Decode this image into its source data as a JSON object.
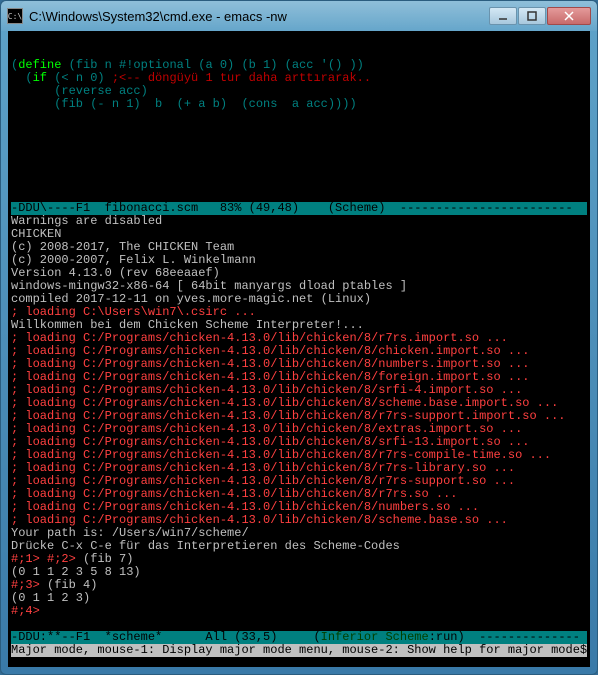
{
  "window": {
    "title": "C:\\Windows\\System32\\cmd.exe - emacs  -nw"
  },
  "code": {
    "l1a": "(",
    "l1b": "define",
    "l1c": " (fib n #!optional (a 0) (b 1) (acc '() ))",
    "l2a": "  (",
    "l2b": "if",
    "l2c": " (< n 0) ",
    "l2d": ";<-- döngüyü 1 tur daha arttırarak..",
    "l3": "      (reverse acc)",
    "l4": "      (fib (- n 1)  b  (+ a b)  (cons  a acc))))"
  },
  "status_upper": "-DDU\\----F1  fibonacci.scm   83% (49,48)    (Scheme)  ------------------------",
  "repl": {
    "warn": "Warnings are disabled",
    "blank": "",
    "chicken": "CHICKEN",
    "c1": "(c) 2008-2017, The CHICKEN Team",
    "c2": "(c) 2000-2007, Felix L. Winkelmann",
    "ver": "Version 4.13.0 (rev 68eeaaef)",
    "plat": "windows-mingw32-x86-64 [ 64bit manyargs dload ptables ]",
    "comp": "compiled 2017-12-11 on yves.more-magic.net (Linux)",
    "load_csirc": "; loading C:\\Users\\win7\\.csirc ...",
    "welcome": "Willkommen bei dem Chicken Scheme Interpreter!...",
    "loads": [
      "; loading C:/Programs/chicken-4.13.0/lib/chicken/8/r7rs.import.so ...",
      "; loading C:/Programs/chicken-4.13.0/lib/chicken/8/chicken.import.so ...",
      "; loading C:/Programs/chicken-4.13.0/lib/chicken/8/numbers.import.so ...",
      "; loading C:/Programs/chicken-4.13.0/lib/chicken/8/foreign.import.so ...",
      "; loading C:/Programs/chicken-4.13.0/lib/chicken/8/srfi-4.import.so ...",
      "; loading C:/Programs/chicken-4.13.0/lib/chicken/8/scheme.base.import.so ...",
      "; loading C:/Programs/chicken-4.13.0/lib/chicken/8/r7rs-support.import.so ...",
      "; loading C:/Programs/chicken-4.13.0/lib/chicken/8/extras.import.so ...",
      "; loading C:/Programs/chicken-4.13.0/lib/chicken/8/srfi-13.import.so ...",
      "; loading C:/Programs/chicken-4.13.0/lib/chicken/8/r7rs-compile-time.so ...",
      "; loading C:/Programs/chicken-4.13.0/lib/chicken/8/r7rs-library.so ...",
      "; loading C:/Programs/chicken-4.13.0/lib/chicken/8/r7rs-support.so ...",
      "; loading C:/Programs/chicken-4.13.0/lib/chicken/8/r7rs.so ...",
      "; loading C:/Programs/chicken-4.13.0/lib/chicken/8/numbers.so ...",
      "; loading C:/Programs/chicken-4.13.0/lib/chicken/8/scheme.base.so ..."
    ],
    "path": "Your path is: /Users/win7/scheme/",
    "hint": "Drücke C-x C-e für das Interpretieren des Scheme-Codes",
    "p1a": "#;1>",
    "p1b": " ",
    "p1c": "#;2>",
    "p1d": " (fib 7)",
    "r1": "(0 1 1 2 3 5 8 13)",
    "p2a": "#;3>",
    "p2b": " (fib 4)",
    "r2": "(0 1 1 2 3)",
    "p3": "#;4>"
  },
  "status_lower_a": "-DDU:**--F1  *scheme*      All (33,5)     ",
  "status_lower_b": "(",
  "status_lower_c": "Inferior Scheme",
  "status_lower_d": ":run",
  "status_lower_e": ")  --------------",
  "minibuf": "Major mode, mouse-1: Display major mode menu, mouse-2: Show help for major mode$"
}
